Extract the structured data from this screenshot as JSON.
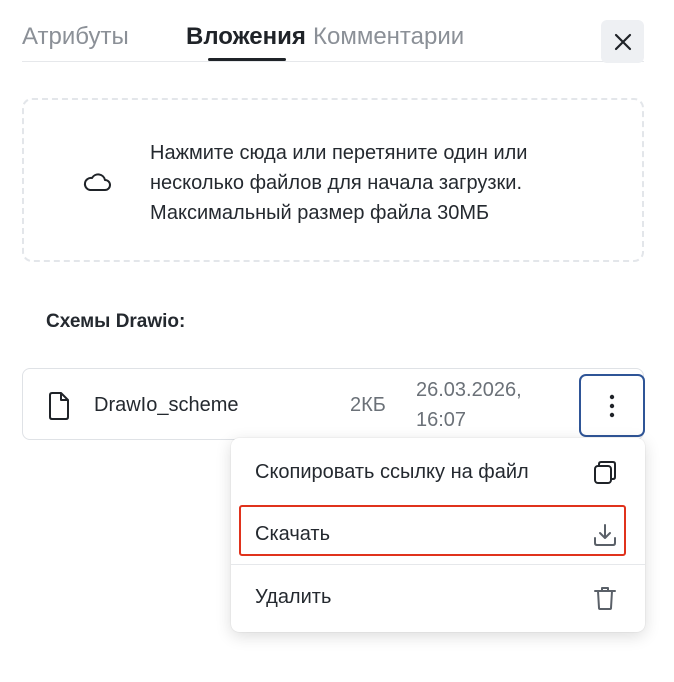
{
  "tabs": [
    {
      "label": "Атрибуты",
      "active": false
    },
    {
      "label": "Вложения",
      "active": true
    },
    {
      "label": "Комментарии",
      "active": false
    }
  ],
  "close_icon": "close-icon",
  "dropzone": {
    "icon": "cloud-icon",
    "text": "Нажмите сюда или перетяните один или\nнесколько файлов для начала загрузки.\nМаксимальный размер файла 30МБ"
  },
  "section": {
    "title": "Схемы Drawio:"
  },
  "file": {
    "icon": "file-icon",
    "name": "DrawIo_scheme",
    "size": "2КБ",
    "date": "26.03.2026,",
    "time": "16:07",
    "menu_icon": "kebab-menu-icon"
  },
  "context_menu": {
    "items": [
      {
        "label": "Скопировать ссылку на файл",
        "icon": "copy-icon"
      },
      {
        "label": "Скачать",
        "icon": "download-icon",
        "highlighted": true
      },
      {
        "label": "Удалить",
        "icon": "trash-icon"
      }
    ]
  },
  "colors": {
    "highlight_border": "#e0321c",
    "focus_border": "#2f5597"
  }
}
